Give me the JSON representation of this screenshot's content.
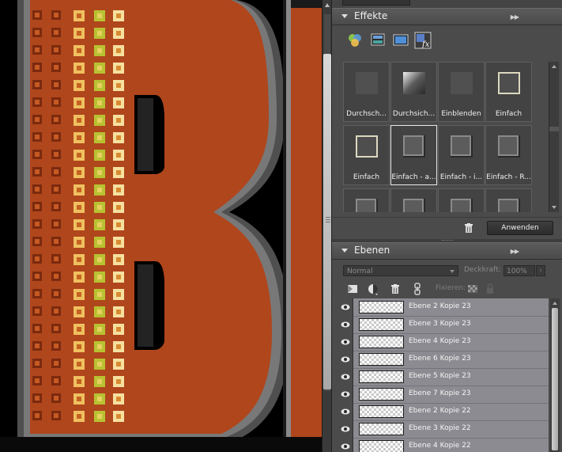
{
  "canvas": {
    "description_icon": "canvas-letter-b",
    "colors": {
      "letter": "#b0461c",
      "background": "#000000",
      "bevel": "#8a8a8a",
      "pattern_dark": "#7c2a0e",
      "pattern_light": "#f0c060",
      "pattern_green": "#b0c030"
    }
  },
  "effects_panel": {
    "title": "Effekte",
    "menu_icon": "panel-menu-icon",
    "icons": [
      "filter-icon",
      "layer-style-icon",
      "photo-effect-icon",
      "fx-icon"
    ],
    "items": [
      {
        "label": "Durchsch...",
        "style": "flat-dark"
      },
      {
        "label": "Durchsich...",
        "style": "glass"
      },
      {
        "label": "Einblenden",
        "style": "flat-dark"
      },
      {
        "label": "Einfach",
        "style": "bevel-light"
      },
      {
        "label": "Einfach",
        "style": "bevel-light"
      },
      {
        "label": "Einfach - a...",
        "style": "bevel-dark",
        "selected": true
      },
      {
        "label": "Einfach - i...",
        "style": "bevel-dark"
      },
      {
        "label": "Einfach - R...",
        "style": "bevel-dark"
      },
      {
        "label": "",
        "style": "bevel-dark"
      },
      {
        "label": "",
        "style": "bevel-dark"
      },
      {
        "label": "",
        "style": "bevel-dark"
      },
      {
        "label": "",
        "style": "bevel-dark"
      }
    ],
    "apply_label": "Anwenden",
    "delete_icon": "trash-icon"
  },
  "layers_panel": {
    "title": "Ebenen",
    "menu_icon": "panel-menu-icon",
    "blend_mode": "Normal",
    "opacity_label": "Deckkraft:",
    "opacity_value": "100%",
    "fix_label": "Fixieren:",
    "tool_icons": [
      "new-layer-icon",
      "adjustment-layer-icon",
      "trash-icon",
      "link-icon"
    ],
    "lock_icons": [
      "lock-transparency-icon",
      "lock-all-icon"
    ],
    "layers": [
      "Ebene 2 Kopie 23",
      "Ebene 3 Kopie 23",
      "Ebene 4 Kopie 23",
      "Ebene 6 Kopie 23",
      "Ebene 5 Kopie 23",
      "Ebene 7 Kopie 23",
      "Ebene 2 Kopie 22",
      "Ebene 3 Kopie 22",
      "Ebene 4 Kopie 22"
    ]
  }
}
